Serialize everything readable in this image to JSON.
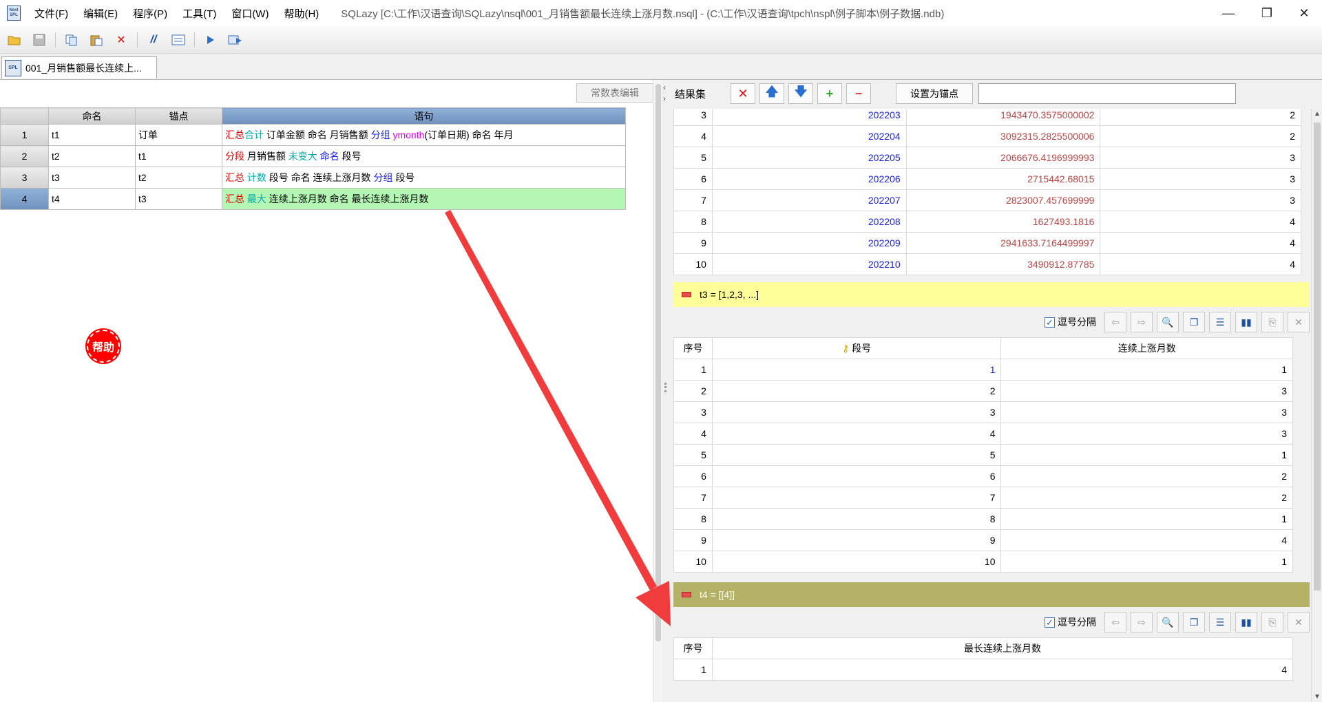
{
  "app": {
    "title": "SQLazy  [C:\\工作\\汉语查询\\SQLazy\\nsql\\001_月销售额最长连续上涨月数.nsql] - (C:\\工作\\汉语查询\\tpch\\nspl\\例子脚本\\例子数据.ndb)",
    "icon_text_top": "Next",
    "icon_text_bottom": "SPL"
  },
  "menu": [
    "文件(F)",
    "编辑(E)",
    "程序(P)",
    "工具(T)",
    "窗口(W)",
    "帮助(H)"
  ],
  "window_controls": {
    "minimize": "—",
    "maximize": "❐",
    "close": "✕"
  },
  "toolbar_icons": [
    "open-folder-icon",
    "save-icon",
    "copy-icon",
    "paste-icon",
    "delete-icon",
    "comment-icon",
    "form-icon",
    "run-icon",
    "step-run-icon"
  ],
  "doc_tab": {
    "label": "001_月销售额最长连续上..."
  },
  "left": {
    "consts_button": "常数表编辑",
    "headers": {
      "name": "命名",
      "anchor": "锚点",
      "expr": "语句"
    },
    "rows": [
      {
        "no": "1",
        "name": "t1",
        "anchor": "订单"
      },
      {
        "no": "2",
        "name": "t2",
        "anchor": "t1"
      },
      {
        "no": "3",
        "name": "t3",
        "anchor": "t2"
      },
      {
        "no": "4",
        "name": "t4",
        "anchor": "t3"
      }
    ],
    "expr_tokens": {
      "r1": [
        "汇总",
        "合计",
        " 订单金额 命名 月销售额 ",
        "分组",
        " ",
        "ymonth",
        "(订单日期) 命名 年月"
      ],
      "r2": [
        "分段",
        " 月销售额 ",
        "未变大",
        " ",
        "命名",
        " 段号"
      ],
      "r3": [
        "汇总",
        " ",
        "计数",
        " 段号 命名 连续上涨月数 ",
        "分组",
        " 段号"
      ],
      "r4": [
        "汇总",
        " ",
        "最大",
        " 连续上涨月数 命名 最长连续上涨月数"
      ]
    },
    "help_label": "帮助"
  },
  "right": {
    "title": "结果集",
    "anchor_button": "设置为锚点",
    "anchor_input": "",
    "top_rows": [
      {
        "seq": "3",
        "ym": "202203",
        "sales": "1943470.3575000002",
        "seg": "2"
      },
      {
        "seq": "4",
        "ym": "202204",
        "sales": "3092315.2825500006",
        "seg": "2"
      },
      {
        "seq": "5",
        "ym": "202205",
        "sales": "2066676.4196999993",
        "seg": "3"
      },
      {
        "seq": "6",
        "ym": "202206",
        "sales": "2715442.68015",
        "seg": "3"
      },
      {
        "seq": "7",
        "ym": "202207",
        "sales": "2823007.457699999",
        "seg": "3"
      },
      {
        "seq": "8",
        "ym": "202208",
        "sales": "1627493.1816",
        "seg": "4"
      },
      {
        "seq": "9",
        "ym": "202209",
        "sales": "2941633.7164499997",
        "seg": "4"
      },
      {
        "seq": "10",
        "ym": "202210",
        "sales": "3490912.87785",
        "seg": "4"
      }
    ],
    "t3": {
      "band": "t3 = [1,2,3, ...]",
      "comma_label": "逗号分隔",
      "headers": {
        "seq": "序号",
        "seg": "段号",
        "count": "连续上涨月数"
      },
      "rows": [
        {
          "seq": "1",
          "seg": "1",
          "count": "1"
        },
        {
          "seq": "2",
          "seg": "2",
          "count": "3"
        },
        {
          "seq": "3",
          "seg": "3",
          "count": "3"
        },
        {
          "seq": "4",
          "seg": "4",
          "count": "3"
        },
        {
          "seq": "5",
          "seg": "5",
          "count": "1"
        },
        {
          "seq": "6",
          "seg": "6",
          "count": "2"
        },
        {
          "seq": "7",
          "seg": "7",
          "count": "2"
        },
        {
          "seq": "8",
          "seg": "8",
          "count": "1"
        },
        {
          "seq": "9",
          "seg": "9",
          "count": "4"
        },
        {
          "seq": "10",
          "seg": "10",
          "count": "1"
        }
      ]
    },
    "t4": {
      "band": "t4 = [[4]]",
      "comma_label": "逗号分隔",
      "headers": {
        "seq": "序号",
        "max": "最长连续上涨月数"
      },
      "rows": [
        {
          "seq": "1",
          "max": "4"
        }
      ]
    }
  },
  "colors": {
    "keyword_red": "#e00000",
    "keyword_teal": "#00a8a8",
    "keyword_blue": "#1a24e0",
    "keyword_magenta": "#e000e0",
    "selected_row": "#b4f6b4",
    "t3_band": "#ffff99",
    "t4_band": "#b3b266",
    "arrow": "#f03c3c"
  }
}
